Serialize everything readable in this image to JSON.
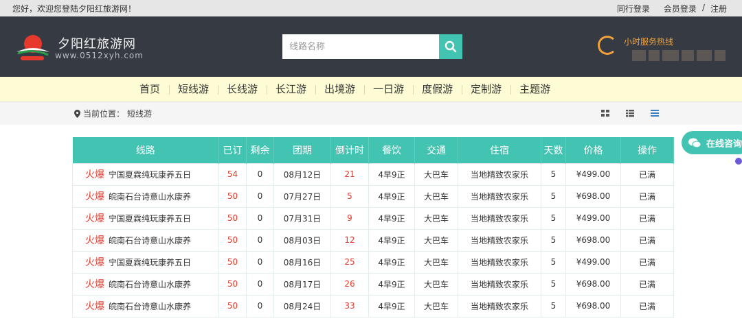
{
  "topbar": {
    "welcome": "您好，欢迎您登陆夕阳红旅游网！",
    "peer_login": "同行登录",
    "member_login": "会员登录",
    "separator": "/",
    "register": "注册"
  },
  "header": {
    "site_name": "夕阳红旅游网",
    "site_url": "www.0512xyh.com",
    "search_placeholder": "线路名称",
    "hotline_label": "小时服务热线"
  },
  "nav": [
    "首页",
    "短线游",
    "长线游",
    "长江游",
    "出境游",
    "一日游",
    "度假游",
    "定制游",
    "主题游"
  ],
  "breadcrumb": {
    "label": "当前位置：",
    "current": "短线游"
  },
  "chat_label": "在线咨询",
  "table": {
    "headers": [
      "线路",
      "已订",
      "剩余",
      "团期",
      "倒计时",
      "餐饮",
      "交通",
      "住宿",
      "天数",
      "价格",
      "操作"
    ],
    "hot_label": "火爆",
    "rows": [
      {
        "route": "宁国夏霖纯玩康养五日",
        "booked": "54",
        "left": "0",
        "date": "08月12日",
        "countdown": "21",
        "meals": "4早9正",
        "transport": "大巴车",
        "stay": "当地精致农家乐",
        "days": "5",
        "price": "¥499.00",
        "action": "已满"
      },
      {
        "route": "皖南石台诗意山水康养",
        "booked": "50",
        "left": "0",
        "date": "07月27日",
        "countdown": "5",
        "meals": "4早9正",
        "transport": "大巴车",
        "stay": "当地精致农家乐",
        "days": "5",
        "price": "¥698.00",
        "action": "已满"
      },
      {
        "route": "宁国夏霖纯玩康养五日",
        "booked": "50",
        "left": "0",
        "date": "07月31日",
        "countdown": "9",
        "meals": "4早9正",
        "transport": "大巴车",
        "stay": "当地精致农家乐",
        "days": "5",
        "price": "¥499.00",
        "action": "已满"
      },
      {
        "route": "皖南石台诗意山水康养",
        "booked": "50",
        "left": "0",
        "date": "08月03日",
        "countdown": "12",
        "meals": "4早9正",
        "transport": "大巴车",
        "stay": "当地精致农家乐",
        "days": "5",
        "price": "¥698.00",
        "action": "已满"
      },
      {
        "route": "宁国夏霖纯玩康养五日",
        "booked": "50",
        "left": "0",
        "date": "08月16日",
        "countdown": "25",
        "meals": "4早9正",
        "transport": "大巴车",
        "stay": "当地精致农家乐",
        "days": "5",
        "price": "¥499.00",
        "action": "已满"
      },
      {
        "route": "皖南石台诗意山水康养",
        "booked": "50",
        "left": "0",
        "date": "08月17日",
        "countdown": "26",
        "meals": "4早9正",
        "transport": "大巴车",
        "stay": "当地精致农家乐",
        "days": "5",
        "price": "¥698.00",
        "action": "已满"
      },
      {
        "route": "皖南石台诗意山水康养",
        "booked": "50",
        "left": "0",
        "date": "08月24日",
        "countdown": "33",
        "meals": "4早9正",
        "transport": "大巴车",
        "stay": "当地精致农家乐",
        "days": "5",
        "price": "¥698.00",
        "action": "已满"
      }
    ]
  },
  "colors": {
    "accent": "#43c3b2",
    "header_bg": "#363b43",
    "nav_bg": "#fdfcd4",
    "hot": "#e23b2c"
  },
  "icons": [
    "search-icon",
    "location-pin-icon",
    "grid-view-icon",
    "list-view-icon",
    "lines-view-icon",
    "chat-icon"
  ]
}
